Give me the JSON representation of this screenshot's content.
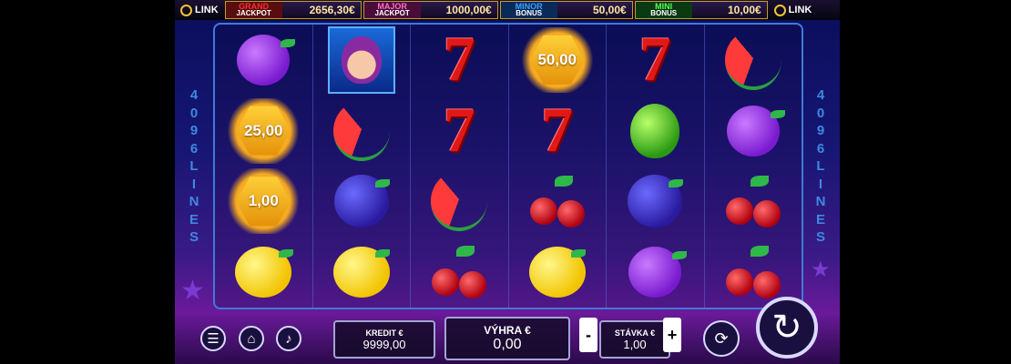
{
  "brand": "LINK",
  "jackpots": [
    {
      "name": "GRAND",
      "sub": "JACKPOT",
      "value": "2656,30€"
    },
    {
      "name": "MAJOR",
      "sub": "JACKPOT",
      "value": "1000,00€"
    },
    {
      "name": "MINOR",
      "sub": "BONUS",
      "value": "50,00€"
    },
    {
      "name": "MINI",
      "sub": "BONUS",
      "value": "10,00€"
    }
  ],
  "lines_label": [
    "4",
    "0",
    "9",
    "6",
    "L",
    "I",
    "N",
    "E",
    "S"
  ],
  "coins": {
    "r4c1": "50,00",
    "r1c2": "25,00",
    "r1c3": "1,00"
  },
  "controls": {
    "kredit_label": "KREDIT €",
    "kredit_value": "9999,00",
    "vyhra_label": "VÝHRA €",
    "vyhra_value": "0,00",
    "stavka_label": "STÁVKA €",
    "stavka_value": "1,00",
    "minus": "-",
    "plus": "+"
  },
  "icons": [
    "menu-icon",
    "home-icon",
    "sound-icon",
    "autoplay-icon",
    "spin-icon"
  ],
  "colors": {
    "accent": "#f5a820",
    "frame": "#3f7bd6",
    "seven": "#e01818"
  }
}
